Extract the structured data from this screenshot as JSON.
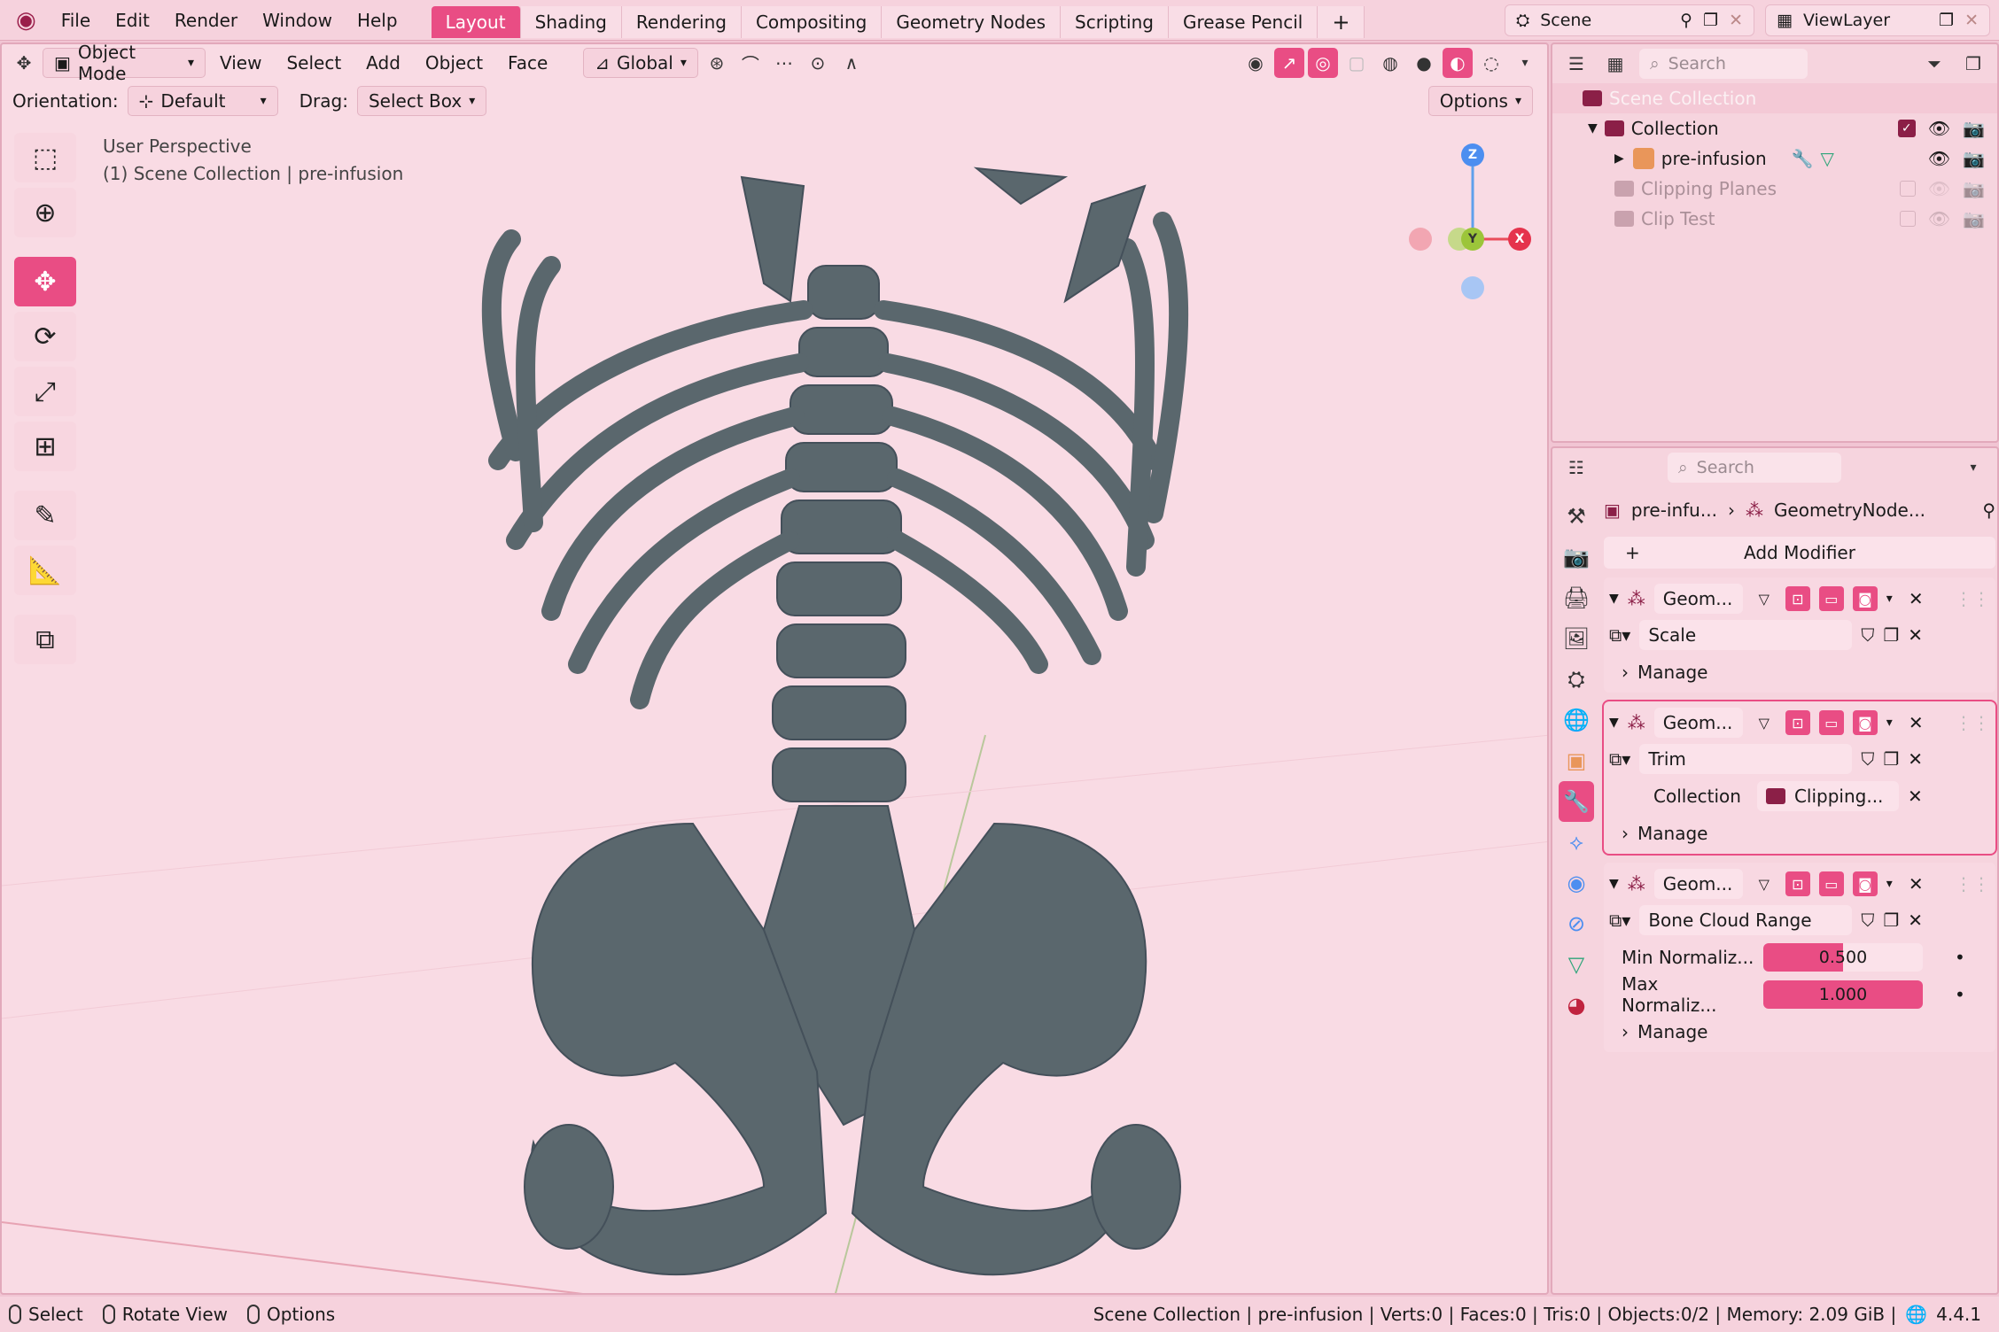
{
  "menu": [
    "File",
    "Edit",
    "Render",
    "Window",
    "Help"
  ],
  "workspaces": [
    {
      "label": "Layout",
      "active": true
    },
    {
      "label": "Shading"
    },
    {
      "label": "Rendering"
    },
    {
      "label": "Compositing"
    },
    {
      "label": "Geometry Nodes"
    },
    {
      "label": "Scripting"
    },
    {
      "label": "Grease Pencil"
    }
  ],
  "scene": "Scene",
  "view_layer": "ViewLayer",
  "viewport": {
    "mode": "Object Mode",
    "menus": [
      "View",
      "Select",
      "Add",
      "Object",
      "Face"
    ],
    "transform": "Global",
    "orientation_label": "Orientation:",
    "orientation_value": "Default",
    "drag_label": "Drag:",
    "drag_value": "Select Box",
    "options": "Options",
    "info_line1": "User Perspective",
    "info_line2": "(1) Scene Collection | pre-infusion",
    "gizmo": {
      "z": "Z",
      "y": "Y",
      "x": "X"
    }
  },
  "outliner": {
    "search_placeholder": "Search",
    "scene_collection": "Scene Collection",
    "collection": "Collection",
    "object": "pre-infusion",
    "clipping": "Clipping Planes",
    "clip_test": "Clip Test"
  },
  "properties": {
    "search_placeholder": "Search",
    "breadcrumb_object": "pre-infu...",
    "breadcrumb_modifier": "GeometryNode...",
    "add_modifier": "Add Modifier",
    "modifiers": [
      {
        "name": "Geom...",
        "node_group": "Scale",
        "manage": "Manage"
      },
      {
        "name": "Geom...",
        "node_group": "Trim",
        "collection_label": "Collection",
        "collection_value": "Clipping...",
        "manage": "Manage"
      },
      {
        "name": "Geom...",
        "node_group": "Bone Cloud Range",
        "min_label": "Min Normaliz...",
        "min_value": "0.500",
        "min_fill": 0.5,
        "max_label": "Max Normaliz...",
        "max_value": "1.000",
        "max_fill": 1.0,
        "manage": "Manage"
      }
    ]
  },
  "status": {
    "select": "Select",
    "rotate": "Rotate View",
    "options": "Options",
    "info": "Scene Collection | pre-infusion | Verts:0 | Faces:0 | Tris:0 | Objects:0/2 | Memory: 2.09 GiB |",
    "version": "4.4.1"
  },
  "colors": {
    "accent": "#e94d84",
    "bone": "#5a676d"
  }
}
